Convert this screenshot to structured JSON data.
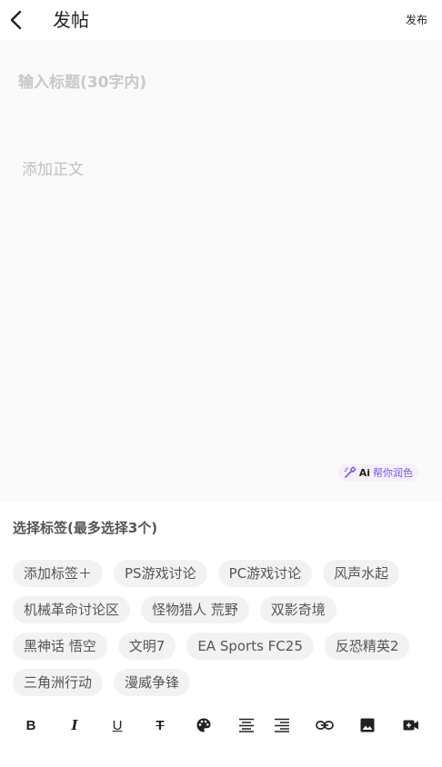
{
  "header": {
    "title": "发帖",
    "publish_label": "发布"
  },
  "editor": {
    "title_placeholder": "输入标题(30字内)",
    "body_placeholder": "添加正文",
    "ai_label_prefix": "Ai",
    "ai_label_suffix": "帮你润色"
  },
  "tags": {
    "heading": "选择标签(最多选择3个)",
    "rows": [
      [
        "添加标签＋",
        "PS游戏讨论",
        "PC游戏讨论",
        "风声水起"
      ],
      [
        "机械革命讨论区",
        "怪物猎人 荒野",
        "双影奇境"
      ],
      [
        "黑神话 悟空",
        "文明7",
        "EA Sports FC25",
        "反恐精英2"
      ],
      [
        "三角洲行动",
        "漫威争锋"
      ]
    ]
  },
  "toolbar": {
    "bold": "B",
    "italic": "I",
    "underline": "U",
    "strike": "T",
    "icons": [
      "palette-icon",
      "align-center-icon",
      "align-right-icon",
      "link-icon",
      "image-icon",
      "video-icon"
    ]
  },
  "colors": {
    "accent": "#7b53d9",
    "chip_bg": "#f2f2f2",
    "editor_bg": "#fafafa"
  }
}
